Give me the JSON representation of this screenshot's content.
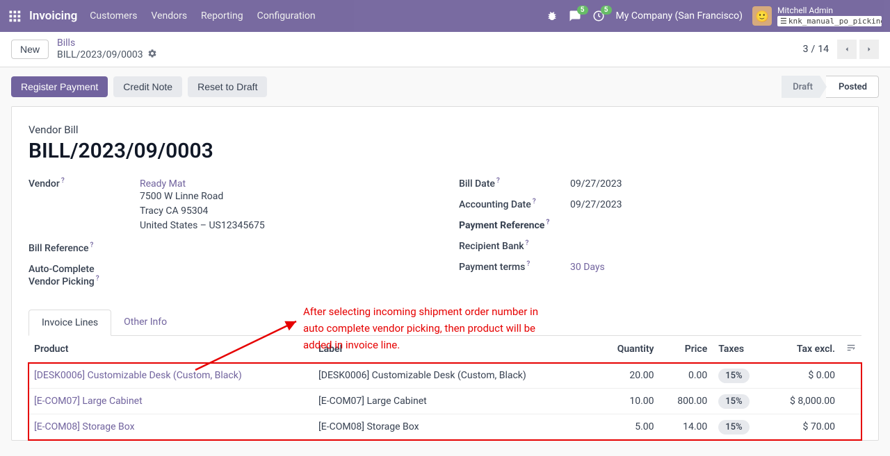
{
  "nav": {
    "app": "Invoicing",
    "items": [
      "Customers",
      "Vendors",
      "Reporting",
      "Configuration"
    ],
    "company": "My Company (San Francisco)",
    "user": "Mitchell Admin",
    "tag": "knk_manual_po_picking_in…",
    "msg_badge": "5",
    "activity_badge": "5"
  },
  "breadcrumb": {
    "parent": "Bills",
    "current": "BILL/2023/09/0003"
  },
  "pager": {
    "pos": "3",
    "total": "14"
  },
  "buttons": {
    "new": "New",
    "register": "Register Payment",
    "credit": "Credit Note",
    "reset": "Reset to Draft"
  },
  "status": {
    "draft": "Draft",
    "posted": "Posted"
  },
  "doc": {
    "label": "Vendor Bill",
    "title": "BILL/2023/09/0003",
    "vendor_label": "Vendor",
    "vendor_name": "Ready Mat",
    "vendor_addr1": "7500 W Linne Road",
    "vendor_addr2": "Tracy CA 95304",
    "vendor_addr3": "United States – US12345675",
    "bill_ref_label": "Bill Reference",
    "auto_label1": "Auto-Complete",
    "auto_label2": "Vendor Picking",
    "bill_date_label": "Bill Date",
    "bill_date": "09/27/2023",
    "acc_date_label": "Accounting Date",
    "acc_date": "09/27/2023",
    "pay_ref_label": "Payment Reference",
    "rec_bank_label": "Recipient Bank",
    "terms_label": "Payment terms",
    "terms": "30 Days"
  },
  "tabs": {
    "lines": "Invoice Lines",
    "other": "Other Info"
  },
  "cols": {
    "product": "Product",
    "label": "Label",
    "qty": "Quantity",
    "price": "Price",
    "taxes": "Taxes",
    "excl": "Tax excl."
  },
  "rows": [
    {
      "product": "[DESK0006] Customizable Desk (Custom, Black)",
      "label": "[DESK0006] Customizable Desk (Custom, Black)",
      "qty": "20.00",
      "price": "0.00",
      "tax": "15%",
      "excl": "$ 0.00"
    },
    {
      "product": "[E-COM07] Large Cabinet",
      "label": "[E-COM07] Large Cabinet",
      "qty": "10.00",
      "price": "800.00",
      "tax": "15%",
      "excl": "$ 8,000.00"
    },
    {
      "product": "[E-COM08] Storage Box",
      "label": "[E-COM08] Storage Box",
      "qty": "5.00",
      "price": "14.00",
      "tax": "15%",
      "excl": "$ 70.00"
    }
  ],
  "annotation": "After selecting incoming shipment order number in auto complete vendor picking, then product will be added in invoice line."
}
